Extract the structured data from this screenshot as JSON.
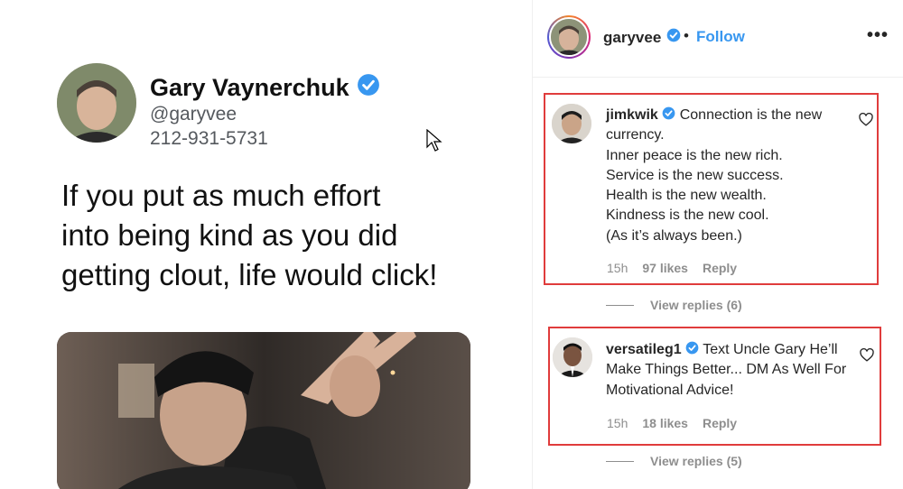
{
  "post": {
    "tweet": {
      "name": "Gary Vaynerchuk",
      "handle": "@garyvee",
      "phone": "212-931-5731",
      "text_lines": [
        "If you put as much effort",
        "into being kind as you did",
        "getting clout, life would click!"
      ]
    }
  },
  "header": {
    "username": "garyvee",
    "separator": "•",
    "follow_label": "Follow",
    "more_label": "•••"
  },
  "comments": [
    {
      "username": "jimkwik",
      "text_first": "Connection is the new currency.",
      "text_lines": [
        "Inner peace is the new rich.",
        "Service is the new success.",
        "Health is the new wealth.",
        "Kindness is the new cool.",
        "(As it’s always been.)"
      ],
      "time": "15h",
      "likes": "97 likes",
      "reply_label": "Reply",
      "view_replies": "View replies (6)"
    },
    {
      "username": "versatileg1",
      "text_first": "Text Uncle Gary He’ll Make Things Better... DM As Well For Motivational Advice!",
      "time": "15h",
      "likes": "18 likes",
      "reply_label": "Reply",
      "view_replies": "View replies (5)"
    }
  ],
  "colors": {
    "accent_blue": "#3897f0",
    "verified_blue": "#3897f0",
    "highlight_red": "#e03c3c"
  }
}
